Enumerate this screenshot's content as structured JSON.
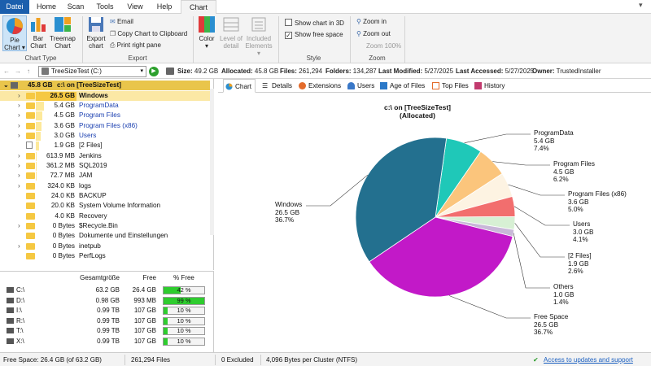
{
  "ribbon_tabs": [
    "Datei",
    "Home",
    "Scan",
    "Tools",
    "View",
    "Help",
    "Chart"
  ],
  "ribbon": {
    "chart_type": {
      "label": "Chart Type",
      "buttons": [
        "Pie\nChart ▾",
        "Bar\nChart",
        "Treemap\nChart"
      ]
    },
    "export": {
      "label": "Export",
      "export_chart": "Export\nchart",
      "email": "Email",
      "copy": "Copy Chart to Clipboard",
      "print": "Print right pane"
    },
    "color": {
      "color": "Color\n▾",
      "level": "Level of\ndetail",
      "included": "Included\nElements ▾"
    },
    "style": {
      "label": "Style",
      "show3d": "Show chart in 3D",
      "show3d_checked": false,
      "freespace": "Show free space",
      "freespace_checked": true
    },
    "zoom": {
      "label": "Zoom",
      "zoom_in": "Zoom in",
      "zoom_out": "Zoom out",
      "zoom100": "Zoom 100%"
    }
  },
  "toolbar": {
    "path": "TreeSizeTest (C:)",
    "size_label": "Size:",
    "size": "49.2 GB",
    "alloc_label": "Allocated:",
    "alloc": "45.8 GB",
    "files_label": "Files:",
    "files": "261,294",
    "folders_label": "Folders:",
    "folders": "134,287",
    "modified_label": "Last Modified:",
    "modified": "5/27/2025",
    "accessed_label": "Last Accessed:",
    "accessed": "5/27/2025",
    "owner_label": "Owner:",
    "owner": "TrustedInstaller"
  },
  "tree": {
    "root": {
      "size": "45.8 GB",
      "name": "c:\\  on  [TreeSizeTest]"
    },
    "rows": [
      {
        "size": "26.5 GB",
        "name": "Windows",
        "pct": 57.9,
        "blue": false,
        "bold": true,
        "file": false,
        "exp": "›"
      },
      {
        "size": "5.4 GB",
        "name": "ProgramData",
        "pct": 11.8,
        "blue": true,
        "bold": false,
        "file": false,
        "exp": "›"
      },
      {
        "size": "4.5 GB",
        "name": "Program Files",
        "pct": 9.8,
        "blue": true,
        "bold": false,
        "file": false,
        "exp": "›"
      },
      {
        "size": "3.6 GB",
        "name": "Program Files (x86)",
        "pct": 7.9,
        "blue": true,
        "bold": false,
        "file": false,
        "exp": "›"
      },
      {
        "size": "3.0 GB",
        "name": "Users",
        "pct": 6.6,
        "blue": true,
        "bold": false,
        "file": false,
        "exp": "›"
      },
      {
        "size": "1.9 GB",
        "name": "[2 Files]",
        "pct": 4.1,
        "blue": false,
        "bold": false,
        "file": true,
        "exp": ""
      },
      {
        "size": "613.9 MB",
        "name": "Jenkins",
        "pct": 1.3,
        "blue": false,
        "bold": false,
        "file": false,
        "exp": "›"
      },
      {
        "size": "361.2 MB",
        "name": "SQL2019",
        "pct": 0.8,
        "blue": false,
        "bold": false,
        "file": false,
        "exp": "›"
      },
      {
        "size": "72.7 MB",
        "name": "JAM",
        "pct": 0.2,
        "blue": false,
        "bold": false,
        "file": false,
        "exp": "›"
      },
      {
        "size": "324.0 KB",
        "name": "logs",
        "pct": 0,
        "blue": false,
        "bold": false,
        "file": false,
        "exp": "›"
      },
      {
        "size": "24.0 KB",
        "name": "BACKUP",
        "pct": 0,
        "blue": false,
        "bold": false,
        "file": false,
        "exp": ""
      },
      {
        "size": "20.0 KB",
        "name": "System Volume Information",
        "pct": 0,
        "blue": false,
        "bold": false,
        "file": false,
        "exp": ""
      },
      {
        "size": "4.0 KB",
        "name": "Recovery",
        "pct": 0,
        "blue": false,
        "bold": false,
        "file": false,
        "exp": ""
      },
      {
        "size": "0 Bytes",
        "name": "$Recycle.Bin",
        "pct": 0,
        "blue": false,
        "bold": false,
        "file": false,
        "exp": "›"
      },
      {
        "size": "0 Bytes",
        "name": "Dokumente und Einstellungen",
        "pct": 0,
        "blue": false,
        "bold": false,
        "file": false,
        "exp": ""
      },
      {
        "size": "0 Bytes",
        "name": "inetpub",
        "pct": 0,
        "blue": false,
        "bold": false,
        "file": false,
        "exp": "›"
      },
      {
        "size": "0 Bytes",
        "name": "PerfLogs",
        "pct": 0,
        "blue": false,
        "bold": false,
        "file": false,
        "exp": ""
      }
    ]
  },
  "drives": {
    "headers": [
      "Gesamtgröße",
      "Free",
      "% Free"
    ],
    "rows": [
      {
        "name": "C:\\",
        "total": "63.2 GB",
        "free": "26.4 GB",
        "pct": "42 %",
        "pctval": 42
      },
      {
        "name": "D:\\",
        "total": "0.98 GB",
        "free": "993 MB",
        "pct": "99 %",
        "pctval": 99
      },
      {
        "name": "I:\\",
        "total": "0.99 TB",
        "free": "107 GB",
        "pct": "10 %",
        "pctval": 10
      },
      {
        "name": "R:\\",
        "total": "0.99 TB",
        "free": "107 GB",
        "pct": "10 %",
        "pctval": 10
      },
      {
        "name": "T:\\",
        "total": "0.99 TB",
        "free": "107 GB",
        "pct": "10 %",
        "pctval": 10
      },
      {
        "name": "X:\\",
        "total": "0.99 TB",
        "free": "107 GB",
        "pct": "10 %",
        "pctval": 10
      }
    ]
  },
  "chart_tabs": [
    "Chart",
    "Details",
    "Extensions",
    "Users",
    "Age of Files",
    "Top Files",
    "History"
  ],
  "chart_data": {
    "type": "pie",
    "title": "c:\\  on  [TreeSizeTest]",
    "subtitle": "(Allocated)",
    "slices": [
      {
        "name": "Windows",
        "size": "26.5 GB",
        "pct": "36.7%",
        "value": 36.7,
        "color": "#23708f"
      },
      {
        "name": "ProgramData",
        "size": "5.4 GB",
        "pct": "7.4%",
        "value": 7.4,
        "color": "#1fc8b8"
      },
      {
        "name": "Program Files",
        "size": "4.5 GB",
        "pct": "6.2%",
        "value": 6.2,
        "color": "#fbc57c"
      },
      {
        "name": "Program Files (x86)",
        "size": "3.6 GB",
        "pct": "5.0%",
        "value": 5.0,
        "color": "#fdf3e2"
      },
      {
        "name": "Users",
        "size": "3.0 GB",
        "pct": "4.1%",
        "value": 4.1,
        "color": "#f26e6e"
      },
      {
        "name": "[2 Files]",
        "size": "1.9 GB",
        "pct": "2.6%",
        "value": 2.6,
        "color": "#d7f0d4"
      },
      {
        "name": "Others",
        "size": "1.0 GB",
        "pct": "1.4%",
        "value": 1.4,
        "color": "#c8b8d8"
      },
      {
        "name": "Free Space",
        "size": "26.5 GB",
        "pct": "36.7%",
        "value": 36.7,
        "color": "#c219c8"
      }
    ]
  },
  "status": {
    "free": "Free Space: 26.4 GB  (of 63.2 GB)",
    "files": "261,294 Files",
    "excluded": "0 Excluded",
    "cluster": "4,096 Bytes per Cluster (NTFS)",
    "link": "Access to updates and support"
  }
}
